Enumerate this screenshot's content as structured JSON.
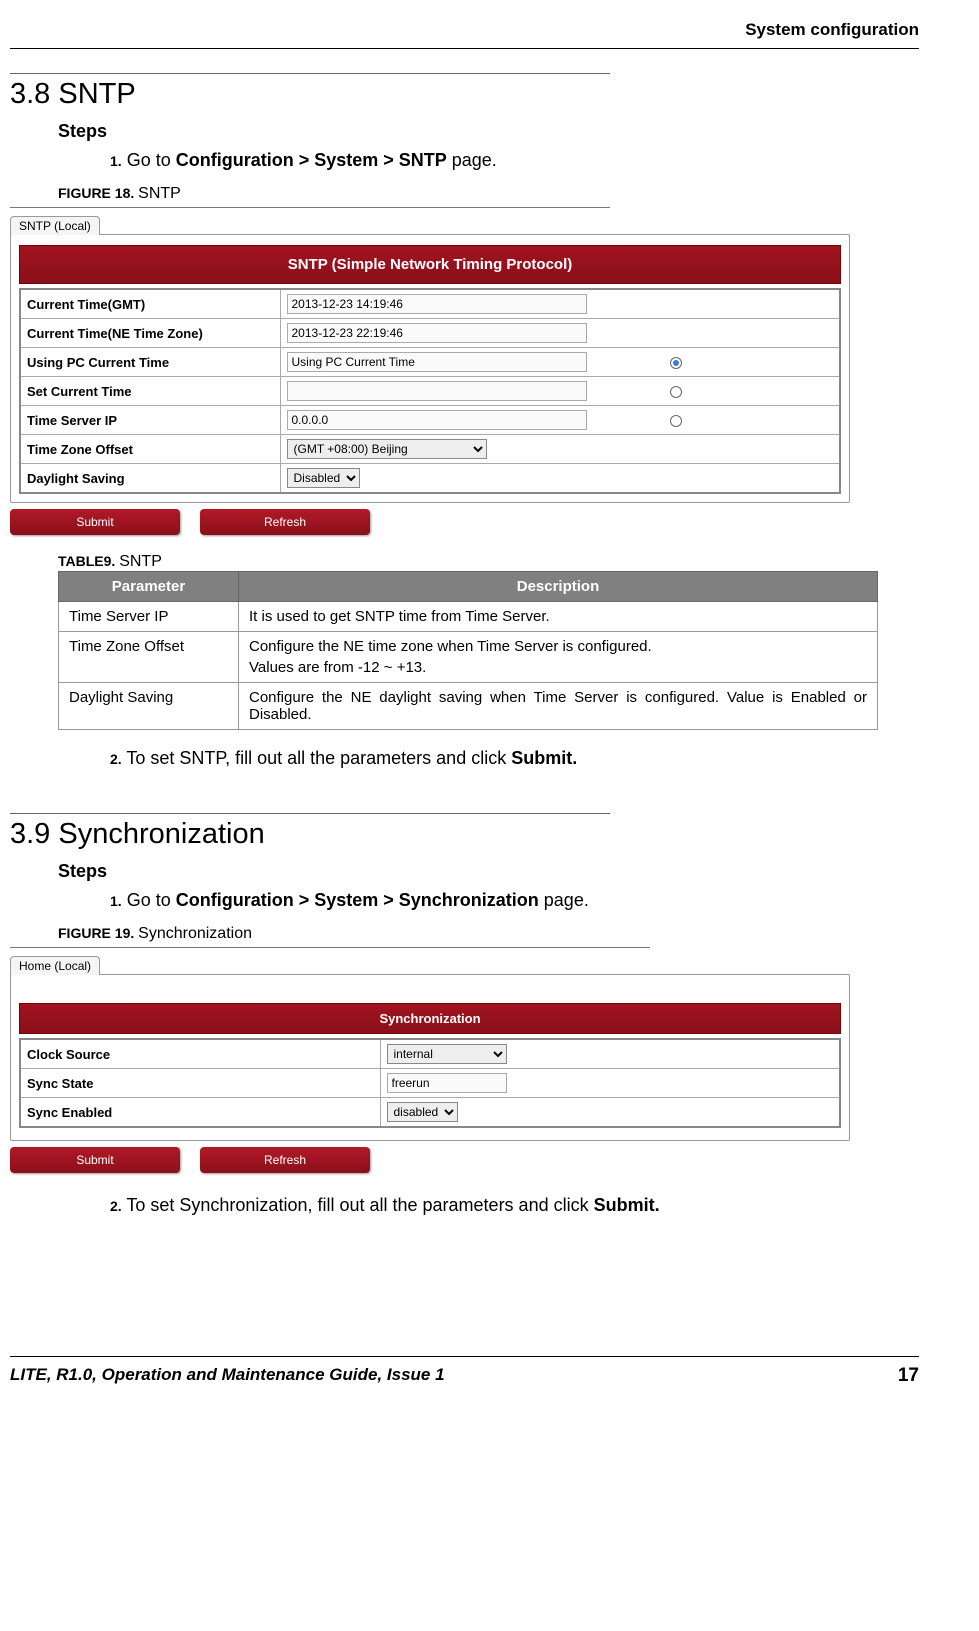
{
  "header": {
    "chapter": "System configuration"
  },
  "sec38": {
    "title": "3.8 SNTP",
    "steps_label": "Steps",
    "step1_num": "1.",
    "step1_pre": " Go to ",
    "step1_bold": "Configuration > System > SNTP",
    "step1_post": " page.",
    "fig_label": "FIGURE 18. ",
    "fig_name": "SNTP",
    "step2_num": "2.",
    "step2_pre": " To set SNTP, fill out all the parameters and click ",
    "step2_bold": "Submit."
  },
  "fig18": {
    "tab": "SNTP (Local)",
    "banner": "SNTP (Simple Network Timing Protocol)",
    "rows": {
      "r0": {
        "label": "Current Time(GMT)",
        "value": "2013-12-23 14:19:46"
      },
      "r1": {
        "label": "Current Time(NE Time Zone)",
        "value": "2013-12-23 22:19:46"
      },
      "r2": {
        "label": "Using PC Current Time",
        "value": "Using PC Current Time"
      },
      "r3": {
        "label": "Set Current Time",
        "value": ""
      },
      "r4": {
        "label": "Time Server IP",
        "value": "0.0.0.0"
      },
      "r5": {
        "label": "Time Zone Offset",
        "value": "(GMT +08:00) Beijing"
      },
      "r6": {
        "label": "Daylight Saving",
        "value": "Disabled"
      }
    },
    "submit": "Submit",
    "refresh": "Refresh"
  },
  "table9": {
    "caption_bold": "TABLE9. ",
    "caption_name": "SNTP",
    "head_param": "Parameter",
    "head_desc": "Description",
    "rows": {
      "r0": {
        "p": "Time Server IP",
        "d": "It is used to get SNTP time from Time Server."
      },
      "r1": {
        "p": "Time Zone Offset",
        "d1": "Configure the NE time zone when Time Server is configured.",
        "d2": "Values are from -12 ~ +13."
      },
      "r2": {
        "p": "Daylight Saving",
        "d": "Configure the NE daylight saving when Time Server is configured. Value is Enabled or Disabled."
      }
    }
  },
  "sec39": {
    "title": "3.9 Synchronization",
    "steps_label": "Steps",
    "step1_num": "1.",
    "step1_pre": " Go to ",
    "step1_bold": "Configuration > System > Synchronization",
    "step1_post": " page.",
    "fig_label": "FIGURE 19. ",
    "fig_name": "Synchronization",
    "step2_num": "2.",
    "step2_pre": " To set Synchronization, fill out all the parameters and click ",
    "step2_bold": "Submit."
  },
  "fig19": {
    "tab": "Home (Local)",
    "banner": "Synchronization",
    "rows": {
      "r0": {
        "label": "Clock Source",
        "value": "internal"
      },
      "r1": {
        "label": "Sync State",
        "value": "freerun"
      },
      "r2": {
        "label": "Sync Enabled",
        "value": "disabled"
      }
    },
    "submit": "Submit",
    "refresh": "Refresh"
  },
  "footer": {
    "left": "LITE, R1.0, Operation and Maintenance Guide, Issue 1",
    "page": "17"
  }
}
